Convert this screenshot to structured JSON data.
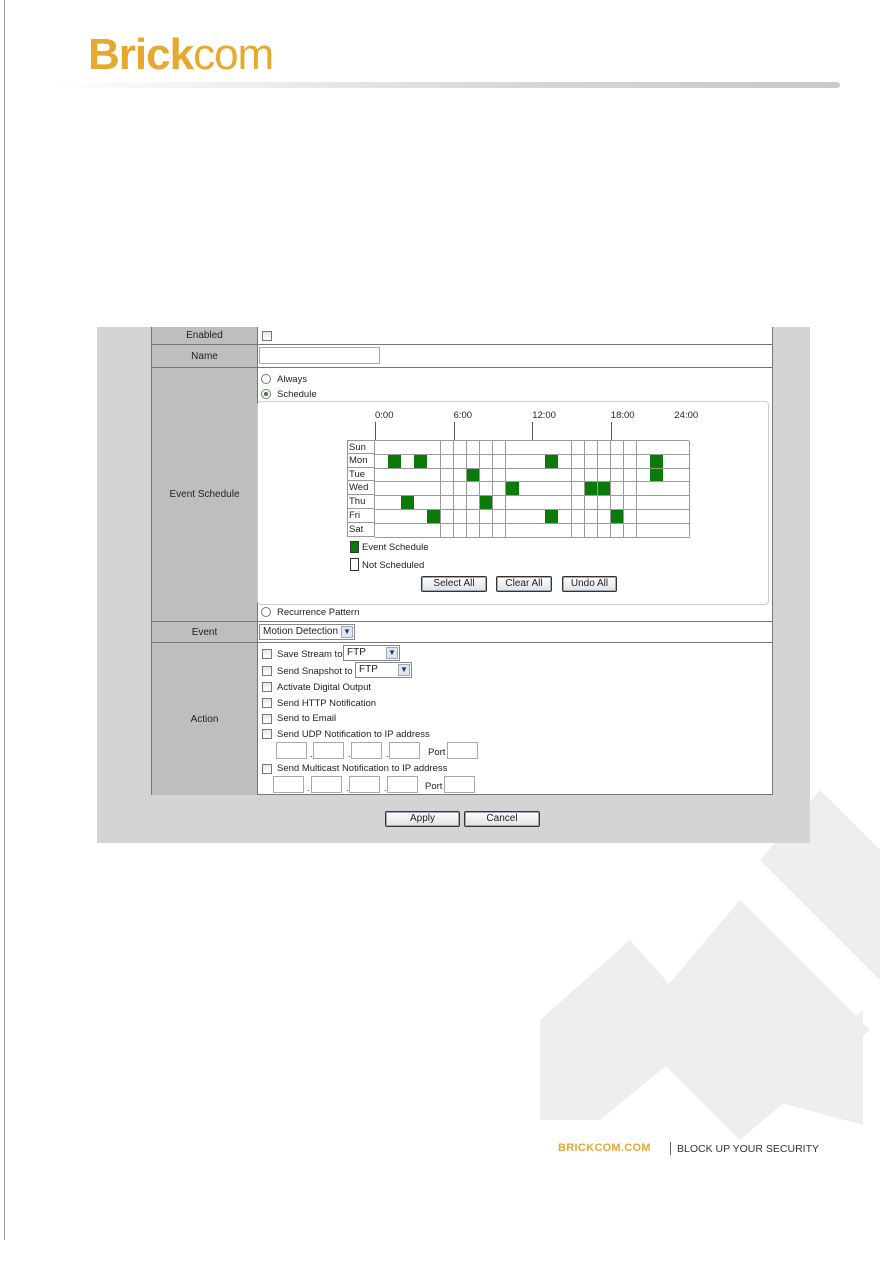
{
  "header": {
    "logo_bold": "Brick",
    "logo_light": "com"
  },
  "form": {
    "enabled_label": "Enabled",
    "name_label": "Name",
    "name_value": "",
    "schedule_label": "Event Schedule",
    "opt_always": "Always",
    "opt_schedule": "Schedule",
    "opt_recurrence": "Recurrence Pattern",
    "selected_option": "Schedule",
    "event_label": "Event",
    "event_value": "Motion Detection",
    "action_label": "Action",
    "actions": {
      "save_stream": "Save Stream to",
      "save_stream_value": "FTP",
      "send_snapshot": "Send Snapshot to",
      "send_snapshot_value": "FTP",
      "digital_output": "Activate Digital Output",
      "http": "Send HTTP Notification",
      "email": "Send to Email",
      "udp": "Send UDP Notification to IP address",
      "multicast": "Send Multicast Notification to IP address",
      "port_label": "Port",
      "dot": "."
    },
    "apply": "Apply",
    "cancel": "Cancel"
  },
  "schedule": {
    "time_labels": [
      "0:00",
      "6:00",
      "12:00",
      "18:00",
      "24:00"
    ],
    "days": [
      "Sun",
      "Mon",
      "Tue",
      "Wed",
      "Thu",
      "Fri",
      "Sat"
    ],
    "scheduled_hours": {
      "Sun": [],
      "Mon": [
        1,
        3,
        13,
        21
      ],
      "Tue": [
        7,
        21
      ],
      "Wed": [
        10,
        16,
        17
      ],
      "Thu": [
        2,
        8
      ],
      "Fri": [
        4,
        13,
        18
      ],
      "Sat": []
    },
    "legend_scheduled": "Event Schedule",
    "legend_not": "Not Scheduled",
    "select_all": "Select All",
    "clear_all": "Clear All",
    "undo_all": "Undo All",
    "colors": {
      "scheduled": "#0a7a0a",
      "empty": "#ffffff"
    }
  },
  "footer": {
    "site": "BRICKCOM.COM",
    "tagline": "BLOCK UP YOUR SECURITY"
  }
}
